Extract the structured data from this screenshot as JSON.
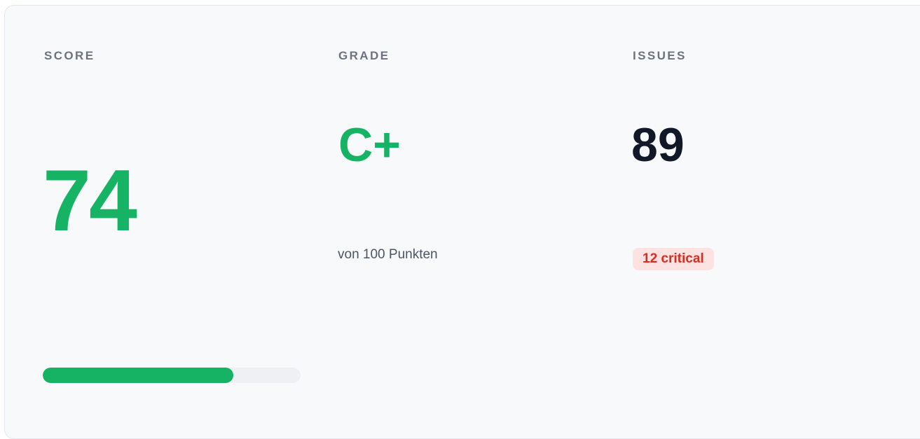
{
  "colors": {
    "accent_green": "#16b364",
    "critical_red": "#d92d20",
    "critical_bg": "#fde2e1",
    "text_dark": "#111827",
    "label_gray": "#6b7280"
  },
  "score": {
    "label": "SCORE",
    "value": "74",
    "progress": 0.74
  },
  "grade": {
    "label": "GRADE",
    "value": "C+",
    "subtext": "von 100 Punkten"
  },
  "issues": {
    "label": "ISSUES",
    "value": "89",
    "critical_badge": "12 critical"
  }
}
